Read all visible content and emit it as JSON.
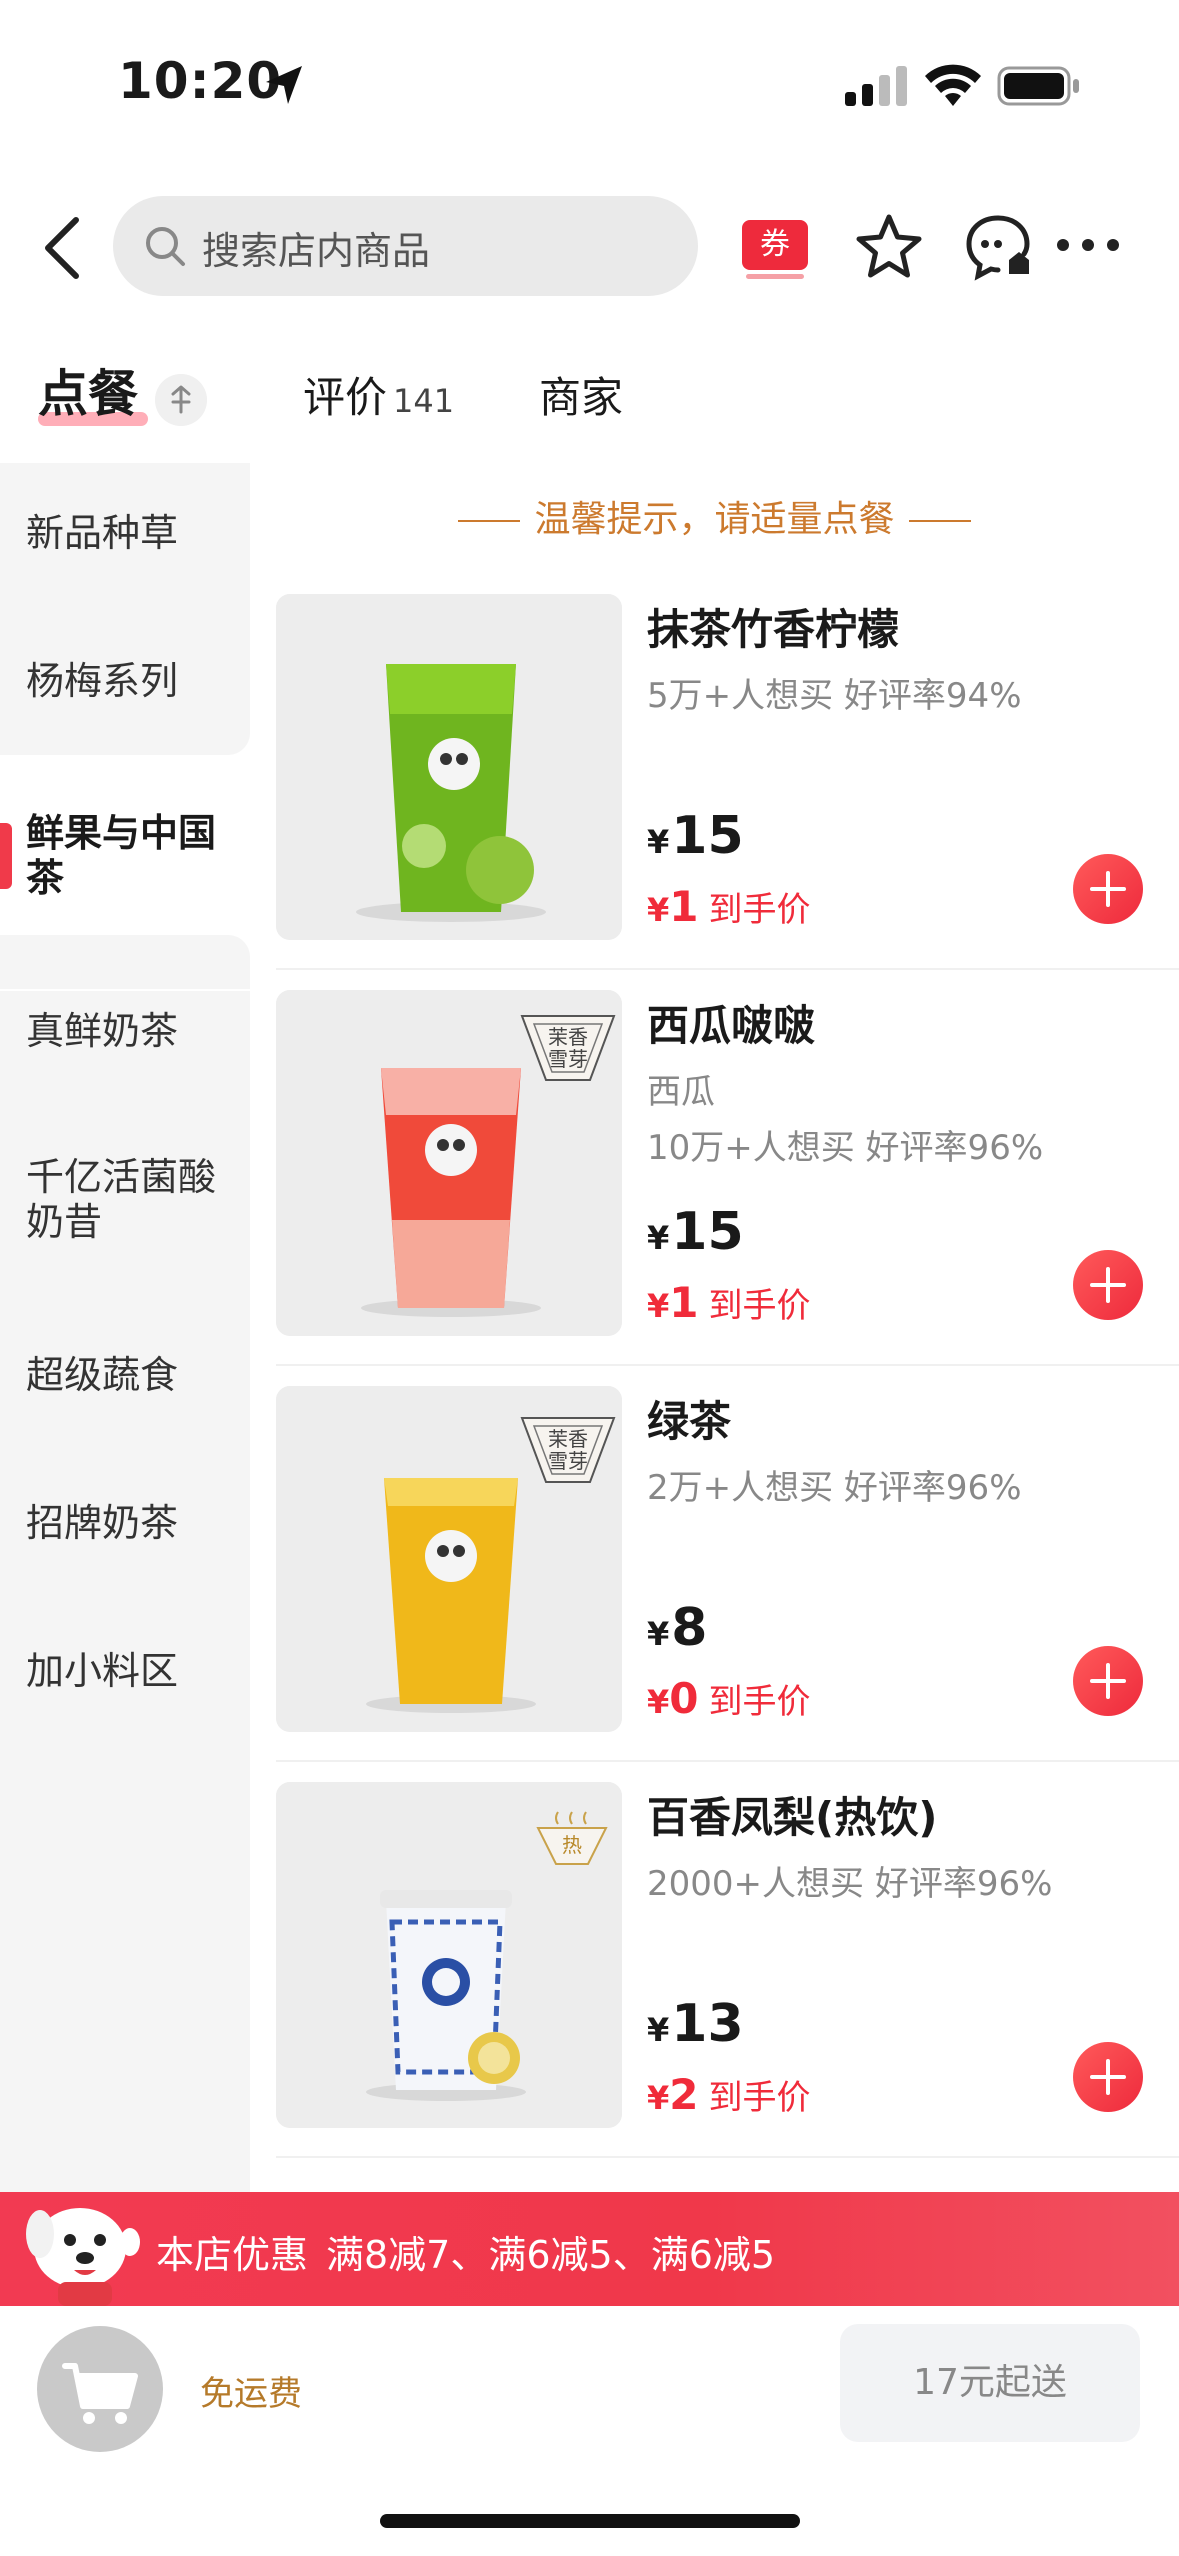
{
  "status_bar": {
    "time": "10:20"
  },
  "nav": {
    "search_placeholder": "搜索店内商品",
    "coupon_label": "券"
  },
  "tabs": {
    "order": "点餐",
    "review": "评价",
    "review_count": "141",
    "merchant": "商家"
  },
  "sidebar": {
    "categories": [
      "新品种草",
      "杨梅系列",
      "鲜果与中国茶",
      "真鲜奶茶",
      "千亿活菌酸奶昔",
      "超级蔬食",
      "招牌奶茶",
      "加小料区"
    ],
    "active_index": 2
  },
  "tip": "温馨提示，请适量点餐",
  "products": [
    {
      "name": "抹茶竹香柠檬",
      "sub1": "5万+人想买 好评率94%",
      "sub2": "",
      "price": "15",
      "final_price": "1",
      "final_label": "到手价",
      "badge": ""
    },
    {
      "name": "西瓜啵啵",
      "sub1": "西瓜",
      "sub2": "10万+人想买 好评率96%",
      "price": "15",
      "final_price": "1",
      "final_label": "到手价",
      "badge": "茉香雪芽"
    },
    {
      "name": "绿茶",
      "sub1": "2万+人想买 好评率96%",
      "sub2": "",
      "price": "8",
      "final_price": "0",
      "final_label": "到手价",
      "badge": "茉香雪芽"
    },
    {
      "name": "百香凤梨(热饮)",
      "sub1": "2000+人想买 好评率96%",
      "sub2": "",
      "price": "13",
      "final_price": "2",
      "final_label": "到手价",
      "badge": "热"
    }
  ],
  "currency_symbol": "¥",
  "promo": {
    "title": "本店优惠",
    "detail": "满8减7、满6减5、满6减5"
  },
  "bottom": {
    "free_delivery": "免运费",
    "min_order": "17元起送"
  },
  "colors": {
    "accent_red": "#f02b3a",
    "tip_orange": "#cc7a2e"
  }
}
